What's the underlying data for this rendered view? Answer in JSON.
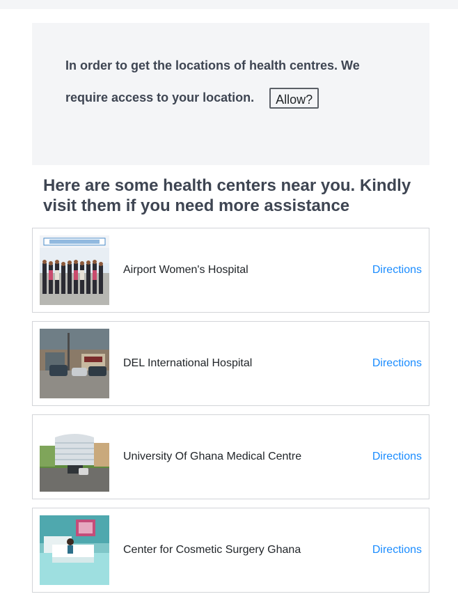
{
  "location_prompt": {
    "message": "In order to get the locations of health centres. We require access to your location.",
    "allow_button_label": "Allow?"
  },
  "heading": "Here are some health centers near you. Kindly visit them if you need more assistance",
  "centers": [
    {
      "name": "Airport Women's Hospital",
      "directions_label": "Directions"
    },
    {
      "name": "DEL International Hospital",
      "directions_label": "Directions"
    },
    {
      "name": "University Of Ghana Medical Centre",
      "directions_label": "Directions"
    },
    {
      "name": "Center for Cosmetic Surgery Ghana",
      "directions_label": "Directions"
    }
  ],
  "colors": {
    "panel_background": "#f4f5f7",
    "link": "#1a8cff",
    "heading_text": "#3e4552"
  }
}
